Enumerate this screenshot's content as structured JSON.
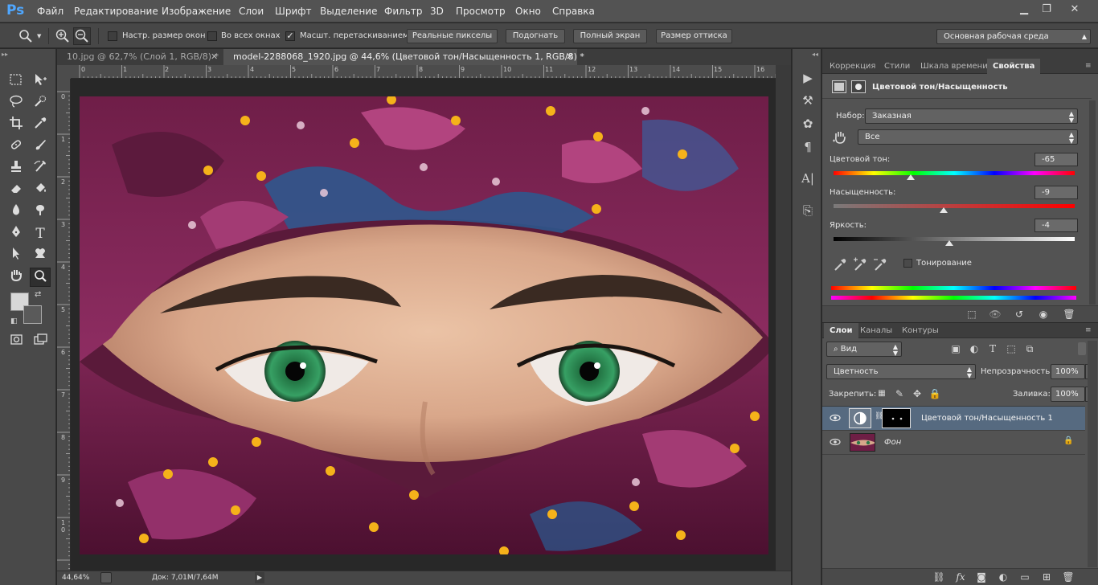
{
  "app": {
    "logo": "Ps"
  },
  "menu": [
    "Файл",
    "Редактирование",
    "Изображение",
    "Слои",
    "Шрифт",
    "Выделение",
    "Фильтр",
    "3D",
    "Просмотр",
    "Окно",
    "Справка"
  ],
  "window_controls": {
    "minimize": "▁",
    "restore": "❐",
    "close": "✕"
  },
  "options": {
    "resize_windows": "Настр. размер окон",
    "all_windows": "Во всех окнах",
    "scrubby_zoom": "Масшт. перетаскиванием",
    "actual_pixels": "Реальные пикселы",
    "fit_screen": "Подогнать",
    "fill_screen": "Полный экран",
    "print_size": "Размер оттиска",
    "workspace": "Основная рабочая среда"
  },
  "documents": [
    {
      "title": "10.jpg @ 62,7% (Слой 1, RGB/8) *",
      "active": false
    },
    {
      "title": "model-2288068_1920.jpg @ 44,6% (Цветовой тон/Насыщенность 1, RGB/8) *",
      "active": true
    }
  ],
  "ruler": {
    "h": [
      "0",
      "1",
      "2",
      "3",
      "4",
      "5",
      "6",
      "7",
      "8",
      "9",
      "10",
      "11",
      "12",
      "13",
      "14",
      "15",
      "16"
    ],
    "v": [
      "0",
      "1",
      "2",
      "3",
      "4",
      "5",
      "6",
      "7",
      "8",
      "9",
      "1\n0"
    ]
  },
  "status": {
    "zoom": "44,64%",
    "doc": "Док: 7,01M/7,64M"
  },
  "properties": {
    "tabs": [
      "Коррекция",
      "Стили",
      "Шкала времени",
      "Свойства"
    ],
    "title": "Цветовой тон/Насыщенность",
    "preset_label": "Набор:",
    "preset_value": "Заказная",
    "channel_value": "Все",
    "hue_label": "Цветовой тон:",
    "hue_value": "-65",
    "hue_level": -65,
    "saturation_label": "Насыщенность:",
    "saturation_value": "-9",
    "saturation_level": -9,
    "lightness_label": "Яркость:",
    "lightness_value": "-4",
    "lightness_level": -4,
    "colorize_label": "Тонирование"
  },
  "layers": {
    "tabs": [
      "Слои",
      "Каналы",
      "Контуры"
    ],
    "filter_kind": "Вид",
    "blend_mode": "Цветность",
    "opacity_label": "Непрозрачность:",
    "opacity_value": "100%",
    "lock_label": "Закрепить:",
    "fill_label": "Заливка:",
    "fill_value": "100%",
    "items": [
      {
        "name": "Цветовой тон/Насыщенность 1",
        "selected": true
      },
      {
        "name": "Фон",
        "selected": false
      }
    ]
  },
  "colors": {
    "accent": "#4fa7ff",
    "selected_layer": "#566a80"
  }
}
